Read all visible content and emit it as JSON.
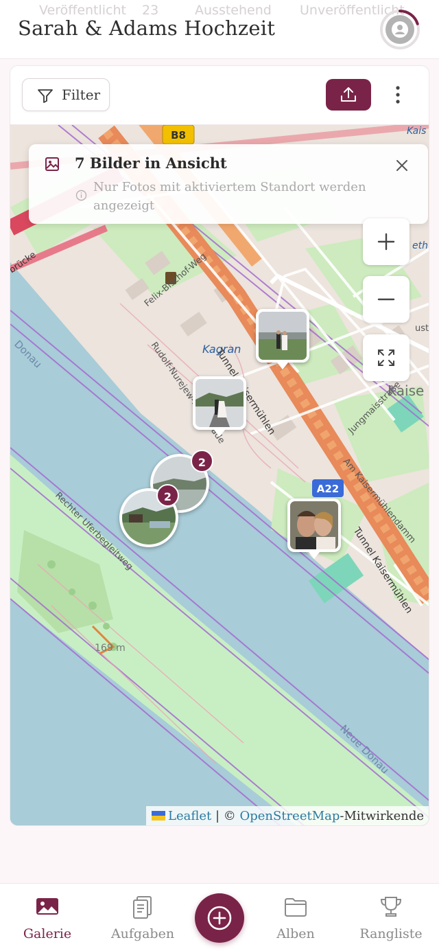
{
  "header": {
    "title": "Sarah & Adams Hochzeit",
    "stats": [
      {
        "label": "Veröffentlicht"
      },
      {
        "label": "23"
      },
      {
        "label": "Ausstehend"
      },
      {
        "label": "Unveröffentlicht"
      }
    ],
    "avatar_icon": "user-avatar-icon",
    "avatar_ring_progress": 0.2
  },
  "toolbar": {
    "filter_label": "Filter",
    "filter_icon": "filter-funnel-icon",
    "upload_icon": "upload-icon",
    "more_icon": "more-vertical-icon"
  },
  "map": {
    "banner": {
      "title": "7 Bilder in Ansicht",
      "subtitle": "Nur Fotos mit aktiviertem Standort werden angezeigt",
      "close_icon": "close-icon"
    },
    "controls": {
      "zoom_in_icon": "plus-icon",
      "zoom_out_icon": "minus-icon",
      "fullscreen_icon": "fullscreen-icon"
    },
    "labels": {
      "road_b8": "B8",
      "road_a22": "A22",
      "kagran": "Kagran",
      "felix": "Felix-Bischof-Weg",
      "rudolf": "Rudolf-Nurejew-Promenade",
      "tunnel1": "Tunnel Kaisermühlen",
      "tunnel2": "Tunnel Kaisermühlen",
      "jungmais": "Jungmaisstraße",
      "amkaiser": "Am Kaisermühlendamm",
      "rechter": "Rechter Uferbegleitweg",
      "neue_donau": "Neue Donau",
      "donau": "Donau",
      "bruecke": "brücke",
      "kaise": "Kaise",
      "kaise_top": "Kais",
      "eth": "eth",
      "ustr": "ustr",
      "elevation": "169 m"
    },
    "markers": [
      {
        "type": "photo"
      },
      {
        "type": "photo"
      },
      {
        "type": "photo"
      },
      {
        "type": "cluster",
        "count": "2"
      },
      {
        "type": "cluster",
        "count": "2"
      }
    ],
    "attribution": {
      "leaflet": "Leaflet",
      "separator": " | © ",
      "osm": "OpenStreetMap",
      "suffix": "-Mitwirkende"
    }
  },
  "nav": {
    "items": [
      {
        "label": "Galerie",
        "icon": "gallery-icon",
        "active": true
      },
      {
        "label": "Aufgaben",
        "icon": "tasks-clipboard-icon"
      },
      {
        "label": "Alben",
        "icon": "folder-icon"
      },
      {
        "label": "Rangliste",
        "icon": "trophy-icon"
      }
    ],
    "fab_icon": "add-circle-icon"
  },
  "colors": {
    "accent": "#7a2348",
    "water": "#a8ccd8",
    "park": "#c8efc4",
    "highway": "#e88a5a"
  }
}
